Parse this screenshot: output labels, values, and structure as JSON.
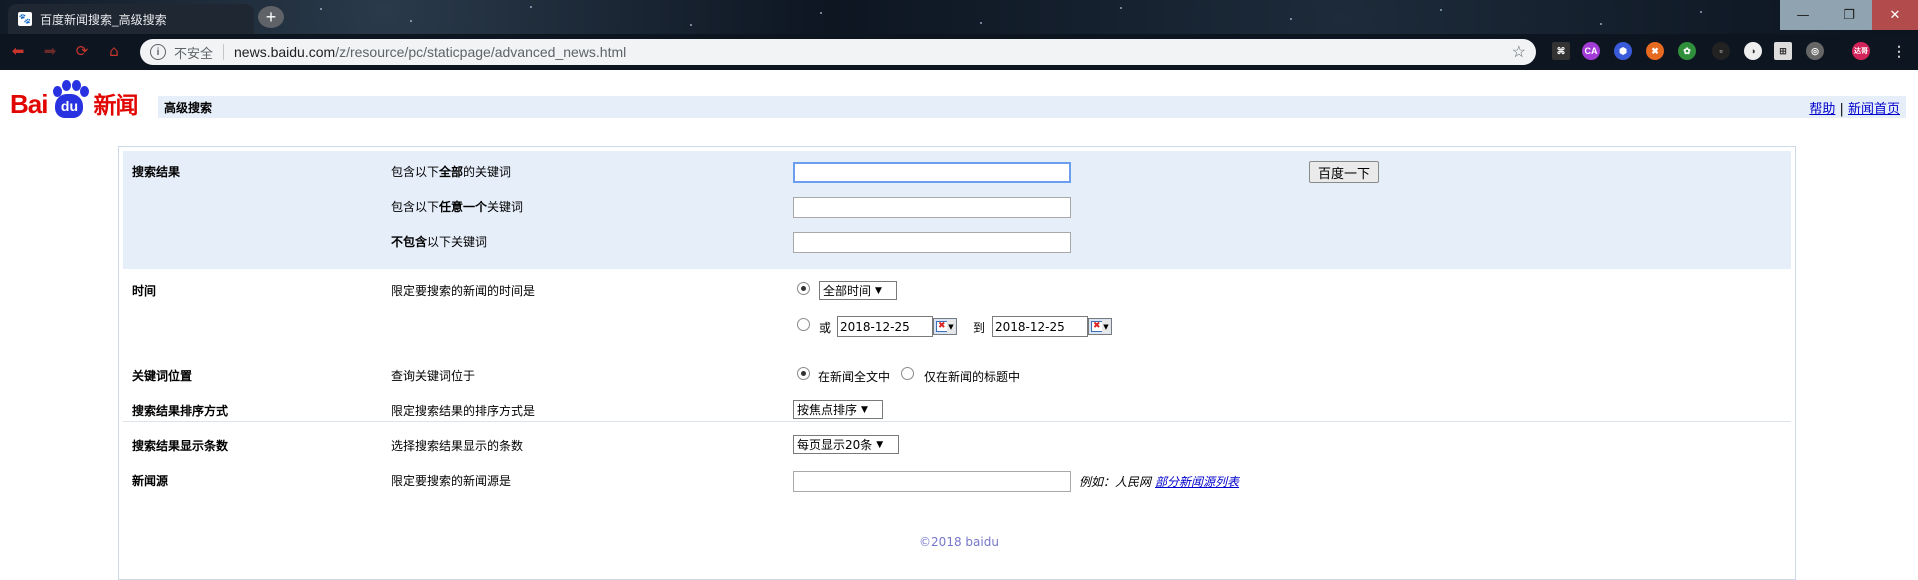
{
  "browser": {
    "tab_title": "百度新闻搜索_高级搜索",
    "new_tab": "+",
    "url_security": "不安全",
    "url_host": "news.baidu.com",
    "url_path": "/z/resource/pc/staticpage/advanced_news.html",
    "win_min": "—",
    "win_max": "❐",
    "win_close": "✕",
    "extensions": [
      "⌘",
      "CA",
      "⬢",
      "✖",
      "✿",
      "▫",
      "◑",
      "⊞",
      "◎",
      "达哥",
      "⋮"
    ]
  },
  "header": {
    "logo_bai": "Bai",
    "logo_du": "du",
    "logo_news": "新闻",
    "title": "高级搜索",
    "help_link": "帮助",
    "link_sep": " | ",
    "home_link": "新闻首页"
  },
  "form": {
    "results_heading": "搜索结果",
    "all_words_label": [
      "包含以下",
      "全部",
      "的关键词"
    ],
    "any_word_label": [
      "包含以下",
      "任意一个",
      "关键词"
    ],
    "none_words_label": [
      "不包含",
      "以下关键词"
    ],
    "all_words_value": "",
    "any_word_value": "",
    "none_words_value": "",
    "submit_label": "百度一下",
    "time_heading": "时间",
    "time_desc": "限定要搜索的新闻的时间是",
    "time_option": "全部时间",
    "or_label": "或",
    "date_from": "2018-12-25",
    "to_label": "到",
    "date_to": "2018-12-25",
    "kwpos_heading": "关键词位置",
    "kwpos_desc": "查询关键词位于",
    "kwpos_fulltext": "在新闻全文中",
    "kwpos_title": "仅在新闻的标题中",
    "sort_heading": "搜索结果排序方式",
    "sort_desc": "限定搜索结果的排序方式是",
    "sort_option": "按焦点排序",
    "count_heading": "搜索结果显示条数",
    "count_desc": "选择搜索结果显示的条数",
    "count_option": "每页显示20条",
    "source_heading": "新闻源",
    "source_desc": "限定要搜索的新闻源是",
    "source_value": "",
    "source_example": "例如：人民网",
    "source_list_link": "部分新闻源列表"
  },
  "footer": {
    "copyright": "©2018 baidu"
  }
}
